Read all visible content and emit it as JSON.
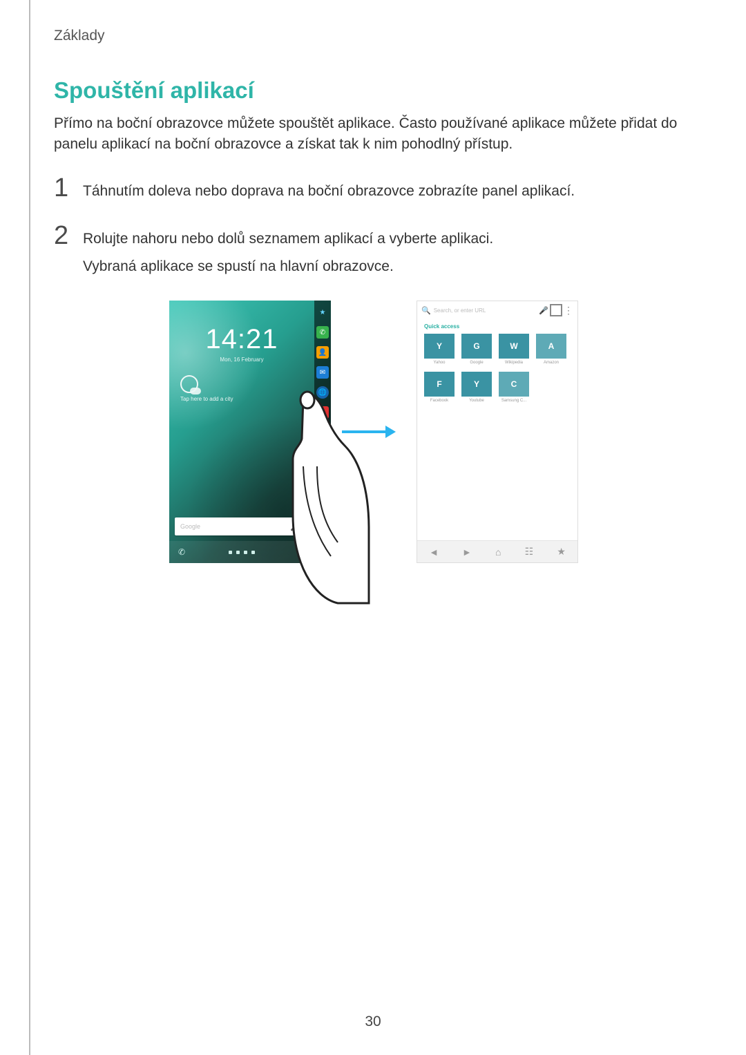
{
  "header": {
    "chapter": "Základy"
  },
  "section": {
    "title": "Spouštění aplikací",
    "intro": "Přímo na boční obrazovce můžete spouštět aplikace. Často používané aplikace můžete přidat do panelu aplikací na boční obrazovce a získat tak k nim pohodlný přístup."
  },
  "steps": [
    {
      "num": "1",
      "lines": [
        "Táhnutím doleva nebo doprava na boční obrazovce zobrazíte panel aplikací."
      ]
    },
    {
      "num": "2",
      "lines": [
        "Rolujte nahoru nebo dolů seznamem aplikací a vyberte aplikaci.",
        "Vybraná aplikace se spustí na hlavní obrazovce."
      ]
    }
  ],
  "left_phone": {
    "time": "14:21",
    "date": "Mon, 16 February",
    "weather_caption": "Tap here to add a city",
    "search_hint": "Google",
    "edge_icons": [
      "star",
      "phone",
      "contacts",
      "message",
      "globe",
      "youtube",
      "mail",
      "play",
      "app"
    ],
    "bottom": {
      "left_icon": "phone",
      "right_icon": "apps"
    }
  },
  "right_phone": {
    "search_placeholder": "Search, or enter URL",
    "quick_access": "Quick access",
    "tiles": [
      {
        "letter": "Y",
        "label": "Yahoo"
      },
      {
        "letter": "G",
        "label": "Google"
      },
      {
        "letter": "W",
        "label": "Wikipedia"
      },
      {
        "letter": "A",
        "label": "Amazon"
      },
      {
        "letter": "F",
        "label": "Facebook"
      },
      {
        "letter": "Y",
        "label": "Youtube"
      },
      {
        "letter": "C",
        "label": "Samsung C..."
      }
    ],
    "nav": [
      "back",
      "forward",
      "home",
      "tabs",
      "bookmark"
    ]
  },
  "page_number": "30"
}
